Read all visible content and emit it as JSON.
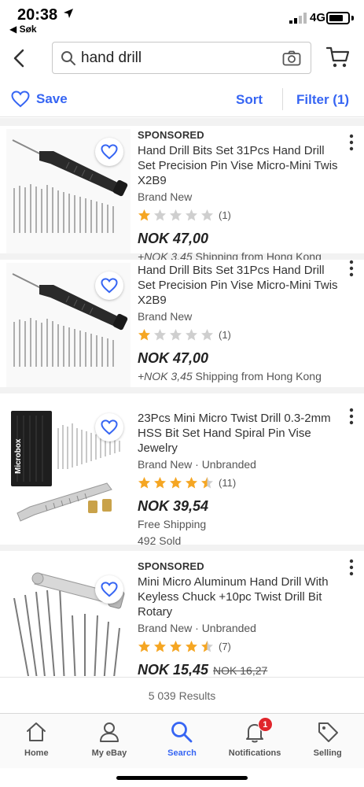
{
  "status": {
    "time": "20:38",
    "back_app": "◀ Søk",
    "network": "4G"
  },
  "search": {
    "query": "hand drill",
    "placeholder": "Search"
  },
  "toolbar": {
    "save_label": "Save",
    "sort_label": "Sort",
    "filter_label": "Filter (1)"
  },
  "colors": {
    "accent": "#3665f3",
    "star_filled": "#f5a623",
    "star_empty": "#cfcfcf",
    "badge": "#e0262c"
  },
  "listings": [
    {
      "sponsored": "SPONSORED",
      "title": "Hand Drill Bits Set 31Pcs Hand Drill Set Precision Pin Vise Micro-Mini Twis X2B9",
      "condition": "Brand New",
      "rating": 1,
      "rating_count": "(1)",
      "price": "NOK 47,00",
      "old_price": "",
      "shipping_price": "+NOK 3,45",
      "shipping_text": " Shipping from Hong Kong",
      "sold": ""
    },
    {
      "sponsored": "",
      "title": "Hand Drill Bits Set 31Pcs Hand Drill Set Precision Pin Vise Micro-Mini Twis X2B9",
      "condition": "Brand New",
      "rating": 1,
      "rating_count": "(1)",
      "price": "NOK 47,00",
      "old_price": "",
      "shipping_price": "+NOK 3,45",
      "shipping_text": " Shipping from Hong Kong",
      "sold": ""
    },
    {
      "sponsored": "",
      "title": "23Pcs Mini Micro Twist Drill 0.3-2mm HSS Bit Set Hand Spiral Pin Vise Jewelry",
      "condition": "Brand New · Unbranded",
      "rating": 4.5,
      "rating_count": "(11)",
      "price": "NOK 39,54",
      "old_price": "",
      "shipping_price": "",
      "shipping_text": "Free Shipping",
      "sold": "492 Sold",
      "thumb_label": "Microbox"
    },
    {
      "sponsored": "SPONSORED",
      "title": "Mini Micro Aluminum Hand Drill With Keyless Chuck +10pc Twist Drill Bit Rotary",
      "condition": "Brand New · Unbranded",
      "rating": 4.5,
      "rating_count": "(7)",
      "price": "NOK 15,45",
      "old_price": "NOK 16,27",
      "shipping_price": "",
      "shipping_text": "",
      "sold": ""
    }
  ],
  "results": "5 039 Results",
  "tabs": [
    {
      "label": "Home",
      "icon": "home-icon"
    },
    {
      "label": "My eBay",
      "icon": "person-icon"
    },
    {
      "label": "Search",
      "icon": "search-icon",
      "active": true
    },
    {
      "label": "Notifications",
      "icon": "bell-icon",
      "badge": "1"
    },
    {
      "label": "Selling",
      "icon": "tag-icon"
    }
  ]
}
